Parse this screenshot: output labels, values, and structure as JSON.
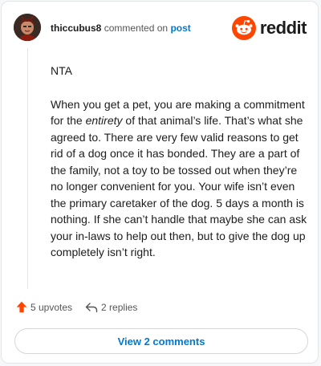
{
  "header": {
    "username": "thiccubus8",
    "commented_on_text": "commented on",
    "post_link": "post",
    "brand_wordmark": "reddit",
    "brand_color": "#ff4500",
    "link_color": "#0079d3"
  },
  "comment": {
    "para1": "NTA",
    "para2_before": "When you get a pet, you are making a commitment for the ",
    "para2_emphasis": "entirety",
    "para2_after": " of that animal’s life. That’s what she agreed to. There are very few valid reasons to get rid of a dog once it has bonded. They are a part of the family, not a toy to be tossed out when they’re no longer convenient for you. Your wife isn’t even the primary caretaker of the dog. 5 days a month is nothing. If she can’t handle that maybe she can ask your in-laws to help out then, but to give the dog up completely isn’t right."
  },
  "actions": {
    "upvotes": "5 upvotes",
    "replies": "2 replies"
  },
  "view_comments_label": "View 2 comments",
  "icons": {
    "upvote": "upvote-arrow-icon",
    "reply": "reply-arrow-icon",
    "avatar": "avatar",
    "logo": "reddit-snoo-icon"
  }
}
